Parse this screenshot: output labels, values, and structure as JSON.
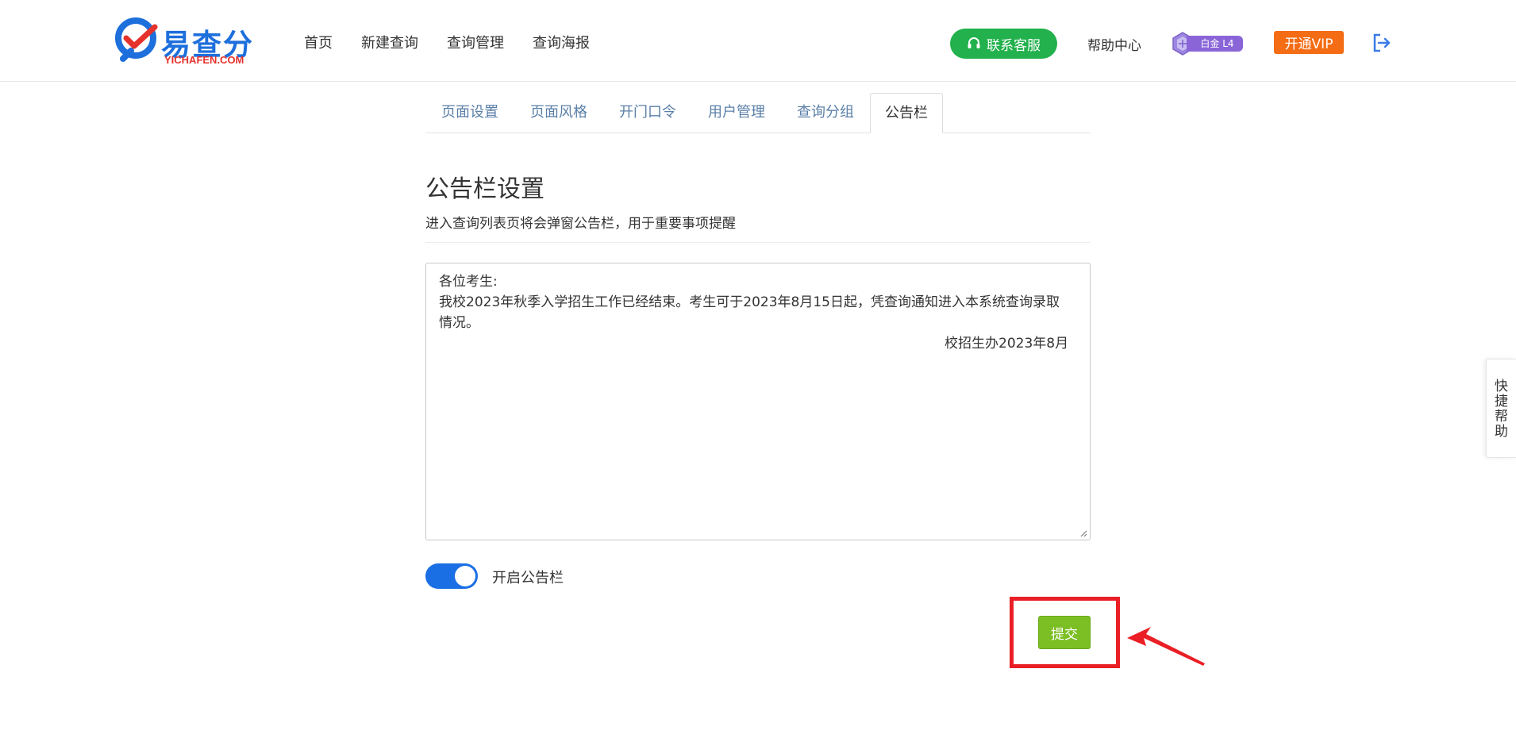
{
  "header": {
    "logo_text": "易查分",
    "logo_sub": "YICHAFEN.COM",
    "nav": [
      "首页",
      "新建查询",
      "查询管理",
      "查询海报"
    ],
    "contact_label": "联系客服",
    "help_label": "帮助中心",
    "level_label": "白金 L4",
    "vip_label": "开通VIP"
  },
  "tabs": [
    "页面设置",
    "页面风格",
    "开门口令",
    "用户管理",
    "查询分组",
    "公告栏"
  ],
  "active_tab": "公告栏",
  "section": {
    "title": "公告栏设置",
    "description": "进入查询列表页将会弹窗公告栏，用于重要事项提醒"
  },
  "notice": {
    "line1": "各位考生:",
    "line2": "我校2023年秋季入学招生工作已经结束。考生可于2023年8月15日起，凭查询通知进入本系统查询录取",
    "line3": "情况。",
    "signature": "校招生办2023年8月"
  },
  "toggle": {
    "label": "开启公告栏",
    "on": true
  },
  "submit_label": "提交",
  "quick_help_label": "快捷帮助",
  "colors": {
    "brand_blue": "#1d6fdc",
    "contact_green": "#22b14c",
    "vip_orange": "#f46c14",
    "submit_green": "#7cbf25",
    "toggle_blue": "#1a6fe4",
    "highlight_red": "#ea1f26"
  }
}
